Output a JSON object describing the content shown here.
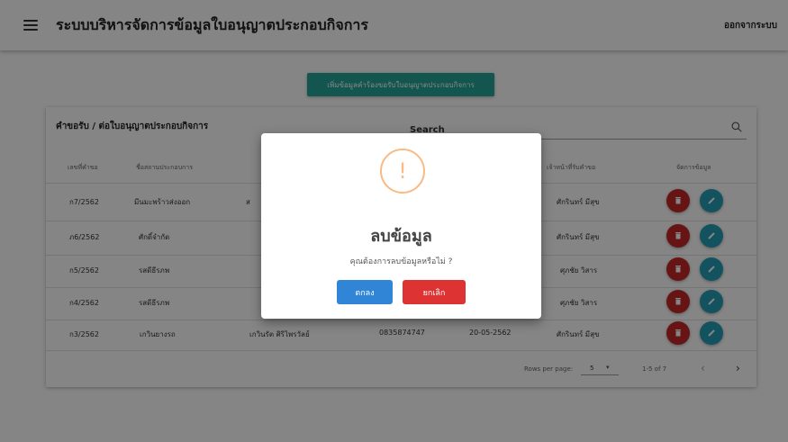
{
  "header": {
    "title": "ระบบบริหารจัดการข้อมูลใบอนุญาตประกอบกิจการ",
    "logout_label": "ออกจากระบบ"
  },
  "add_button_label": "เพิ่มข้อมูลคำร้องขอรับใบอนุญาตประกอบกิจการ",
  "table": {
    "title": "คำขอรับ / ต่อใบอนุญาตประกอบกิจการ",
    "search_placeholder": "Search",
    "headers": [
      "เลขที่คำขอ",
      "ชื่อสถานประกอบการ",
      "",
      "",
      "",
      "เจ้าหน้าที่รับคำขอ",
      "จัดการข้อมูล"
    ],
    "rows": [
      {
        "req_no": "ก7/2562",
        "name": "มีนมะพร้าวส่งออก",
        "owner": "ส",
        "phone": "",
        "date": "",
        "officer": "ศักรินทร์ มีสุข"
      },
      {
        "req_no": "ภ6/2562",
        "name": "ศักดิ์จำกัด",
        "owner": "",
        "phone": "",
        "date": "",
        "officer": "ศักรินทร์ มีสุข"
      },
      {
        "req_no": "ก5/2562",
        "name": "รสดีธีรภพ",
        "owner": "",
        "phone": "",
        "date": "",
        "officer": "ศุภชัย วิสาร"
      },
      {
        "req_no": "ก4/2562",
        "name": "รสดีธีรภพ",
        "owner": "",
        "phone": "",
        "date": "",
        "officer": "ศุภชัย วิสาร"
      },
      {
        "req_no": "ก3/2562",
        "name": "เกวินยางรถ",
        "owner": "เกวินรัต ศิริไพรวัลย์",
        "phone": "0835874747",
        "date": "20-05-2562",
        "officer": "ศักรินทร์ มีสุข"
      }
    ],
    "footer": {
      "rows_per_page_label": "Rows per page:",
      "rows_per_page_value": "5",
      "range": "1-5 of 7"
    }
  },
  "dialog": {
    "icon_glyph": "!",
    "title": "ลบข้อมูล",
    "message": "คุณต้องการลบข้อมูลหรือไม่ ?",
    "ok_label": "ตกลง",
    "cancel_label": "ยกเลิก"
  },
  "colors": {
    "add_button": "#26a69a",
    "delete": "#c62828",
    "edit": "#26a0b8",
    "ok": "#3085d6",
    "cancel": "#dd3333",
    "warning": "#f8bb86"
  }
}
